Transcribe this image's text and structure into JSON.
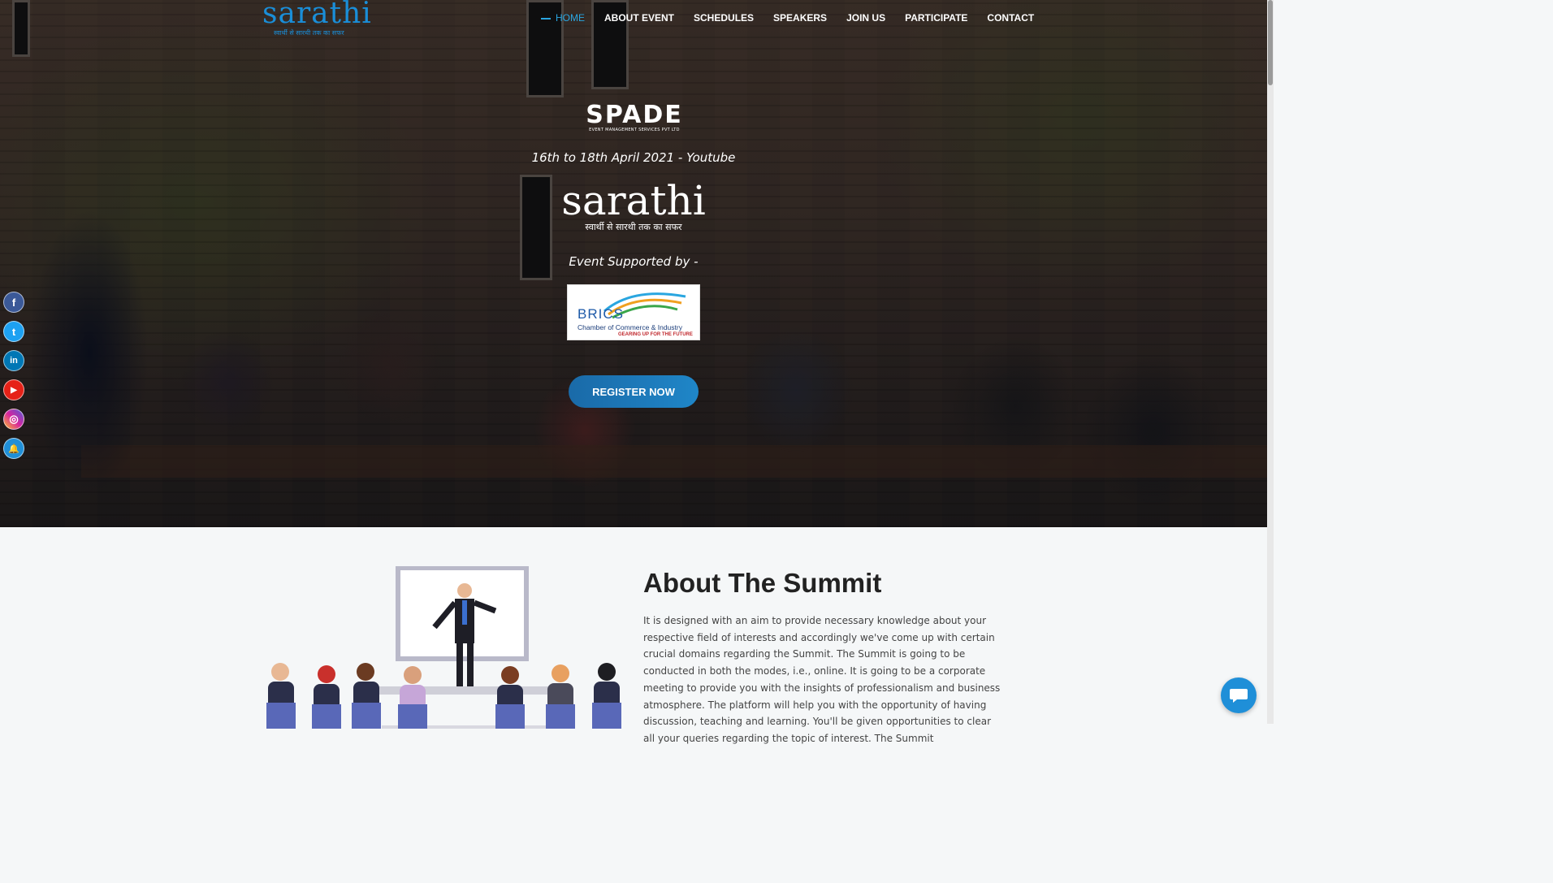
{
  "brand": {
    "logo_text": "sarathi",
    "logo_tagline": "स्वार्थी से सारथी तक का सफर"
  },
  "nav": {
    "items": [
      {
        "label": "HOME",
        "active": true
      },
      {
        "label": "ABOUT EVENT"
      },
      {
        "label": "SCHEDULES"
      },
      {
        "label": "SPEAKERS"
      },
      {
        "label": "JOIN US"
      },
      {
        "label": "PARTICIPATE"
      },
      {
        "label": "CONTACT"
      }
    ]
  },
  "hero": {
    "sponsor_logo": {
      "name": "SPADE",
      "sub": "EVENT MANAGEMENT SERVICES PVT LTD"
    },
    "date_line": "16th to 18th April 2021 - Youtube",
    "event_logo": {
      "name": "sarathi",
      "tagline": "स्वार्थी से सारथी तक का सफर"
    },
    "supported_by": "Event Supported by -",
    "supporter_logo": {
      "name": "BRICS",
      "line2": "Chamber of Commerce & Industry",
      "line3": "GEARING UP FOR THE FUTURE"
    },
    "register_label": "REGISTER NOW"
  },
  "social": [
    {
      "name": "facebook-icon",
      "glyph": "f",
      "color": "#3b5998"
    },
    {
      "name": "twitter-icon",
      "glyph": "t",
      "color": "#1da1f2"
    },
    {
      "name": "linkedin-icon",
      "glyph": "in",
      "color": "#0077b5"
    },
    {
      "name": "youtube-icon",
      "glyph": "▶",
      "color": "#e62117"
    },
    {
      "name": "instagram-icon",
      "glyph": "◎",
      "color": "#d6249f"
    },
    {
      "name": "bell-icon",
      "glyph": "🔔",
      "color": "#1f8fd8"
    }
  ],
  "about": {
    "title": "About The Summit",
    "body": "It is designed with an aim to provide necessary knowledge about your respective field of interests and accordingly we've come up with certain crucial domains regarding the Summit. The Summit is going to be conducted in both the modes, i.e., online. It is going to be a corporate meeting to provide you with the insights of professionalism and business atmosphere. The platform will help you with the opportunity of having discussion, teaching and learning. You'll be given opportunities to clear all your queries regarding the topic of interest. The Summit"
  },
  "colors": {
    "accent": "#2aa6e0",
    "button": "#1f86c8",
    "chat": "#1f8fd8"
  }
}
